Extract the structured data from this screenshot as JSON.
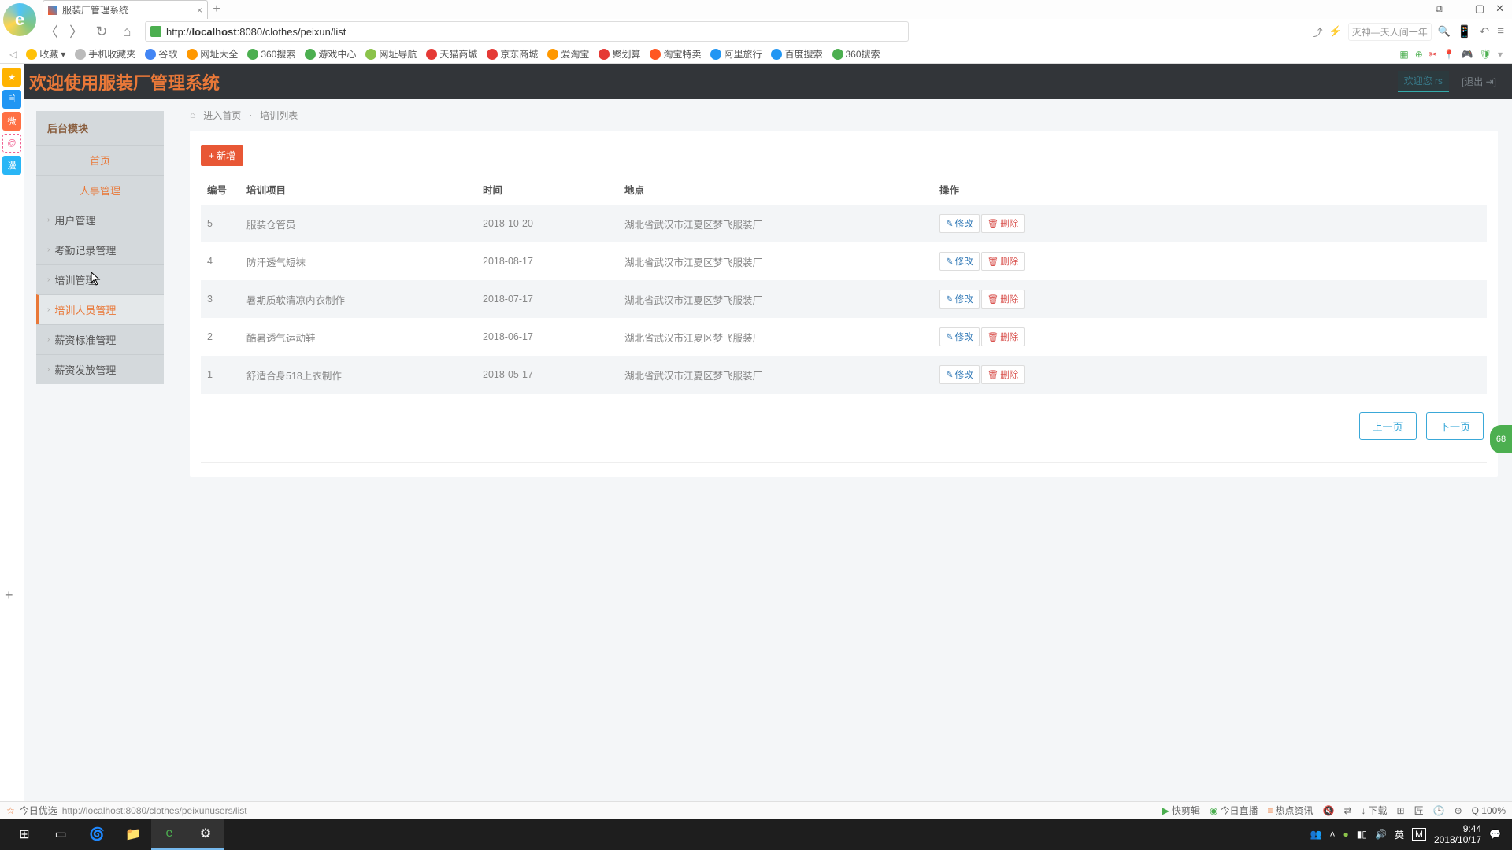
{
  "browser": {
    "tab_title": "服装厂管理系统",
    "url_prefix": "http://",
    "url_host": "localhost",
    "url_rest": ":8080/clothes/peixun/list",
    "search_placeholder": "灭神—天人间一年",
    "window_controls": [
      "☐",
      "—",
      "▢",
      "✕"
    ],
    "bookmarks": [
      {
        "label": "收藏",
        "color": "#ffc107"
      },
      {
        "label": "手机收藏夹",
        "color": "#999"
      },
      {
        "label": "谷歌",
        "color": "#4285f4"
      },
      {
        "label": "网址大全",
        "color": "#ff9800"
      },
      {
        "label": "360搜索",
        "color": "#4caf50"
      },
      {
        "label": "游戏中心",
        "color": "#4caf50"
      },
      {
        "label": "网址导航",
        "color": "#8bc34a"
      },
      {
        "label": "天猫商城",
        "color": "#e53935"
      },
      {
        "label": "京东商城",
        "color": "#e53935"
      },
      {
        "label": "爱淘宝",
        "color": "#ff9800"
      },
      {
        "label": "聚划算",
        "color": "#e53935"
      },
      {
        "label": "淘宝特卖",
        "color": "#ff5722"
      },
      {
        "label": "阿里旅行",
        "color": "#2196f3"
      },
      {
        "label": "百度搜索",
        "color": "#2196f3"
      },
      {
        "label": "360搜索",
        "color": "#4caf50"
      }
    ],
    "status_left_label": "今日优选",
    "status_url": "http://localhost:8080/clothes/peixunusers/list",
    "status_right": [
      "快剪辑",
      "今日直播",
      "热点资讯",
      "↓",
      "下载",
      "⊞",
      "匠",
      "🕒",
      "⊕",
      "Q 100%"
    ]
  },
  "app": {
    "title": "欢迎使用服装厂管理系统",
    "welcome_prefix": "欢迎您",
    "welcome_user": "rs",
    "logout": "[退出 ⇥]"
  },
  "sidebar": {
    "header": "后台模块",
    "items": [
      {
        "label": "首页",
        "type": "center-orange"
      },
      {
        "label": "人事管理",
        "type": "center-orange"
      },
      {
        "label": "用户管理",
        "type": "sub"
      },
      {
        "label": "考勤记录管理",
        "type": "sub"
      },
      {
        "label": "培训管理",
        "type": "sub"
      },
      {
        "label": "培训人员管理",
        "type": "sub-active"
      },
      {
        "label": "薪资标准管理",
        "type": "sub"
      },
      {
        "label": "薪资发放管理",
        "type": "sub"
      }
    ]
  },
  "breadcrumb": {
    "home": "进入首页",
    "current": "培训列表"
  },
  "toolbar": {
    "add_label": "新增"
  },
  "table": {
    "headers": [
      "编号",
      "培训项目",
      "时间",
      "地点",
      "操作"
    ],
    "edit_label": "修改",
    "delete_label": "删除",
    "rows": [
      {
        "id": "5",
        "name": "服装仓管员",
        "time": "2018-10-20",
        "loc": "湖北省武汉市江夏区梦飞服装厂"
      },
      {
        "id": "4",
        "name": "防汗透气短袜",
        "time": "2018-08-17",
        "loc": "湖北省武汉市江夏区梦飞服装厂"
      },
      {
        "id": "3",
        "name": "暑期质软清凉内衣制作",
        "time": "2018-07-17",
        "loc": "湖北省武汉市江夏区梦飞服装厂"
      },
      {
        "id": "2",
        "name": "酷暑透气运动鞋",
        "time": "2018-06-17",
        "loc": "湖北省武汉市江夏区梦飞服装厂"
      },
      {
        "id": "1",
        "name": "舒适合身518上衣制作",
        "time": "2018-05-17",
        "loc": "湖北省武汉市江夏区梦飞服装厂"
      }
    ]
  },
  "pager": {
    "prev": "上一页",
    "next": "下一页"
  },
  "taskbar": {
    "time": "9:44",
    "date": "2018/10/17",
    "ime": "英",
    "float_badge": "68"
  }
}
